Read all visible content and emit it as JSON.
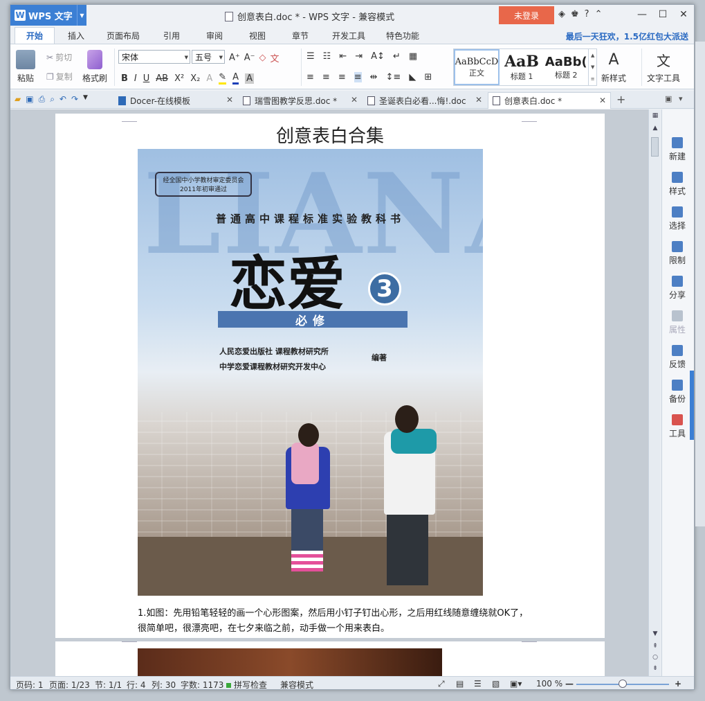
{
  "app": {
    "name": "WPS 文字",
    "window_title": "创意表白.doc * - WPS 文字 - 兼容模式",
    "login_label": "未登录",
    "help_label": "?"
  },
  "menu": {
    "tabs": [
      "开始",
      "插入",
      "页面布局",
      "引用",
      "审阅",
      "视图",
      "章节",
      "开发工具",
      "特色功能"
    ],
    "promo": "最后一天狂欢，1.5亿红包大派送"
  },
  "ribbon": {
    "paste": "粘贴",
    "cut": "剪切",
    "copy": "复制",
    "format_painter": "格式刷",
    "font_name": "宋体",
    "font_size": "五号",
    "styles": [
      {
        "sample": "AaBbCcD",
        "name": "正文"
      },
      {
        "sample": "AaB",
        "name": "标题 1"
      },
      {
        "sample": "AaBb(",
        "name": "标题 2"
      }
    ],
    "new_style": "新样式",
    "text_tools": "文字工具"
  },
  "doc_tabs": [
    {
      "label": "Docer-在线模板"
    },
    {
      "label": "瑞雪图教学反思.doc *"
    },
    {
      "label": "圣诞表白必看...悔!.doc"
    },
    {
      "label": "创意表白.doc *"
    }
  ],
  "document": {
    "title": "创意表白合集",
    "cover": {
      "bg_letters": "LIANAI",
      "seal_line1": "经全国中小学教材审定委员会",
      "seal_line2": "2011年初审通过",
      "series": "普通高中课程标准实验教科书",
      "big_title": "恋爱",
      "volume": "3",
      "band": "必修",
      "publisher_line1": "人民恋爱出版社 课程教材研究所",
      "publisher_line2": "中学恋爱课程教材研究开发中心",
      "edit_label": "编著"
    },
    "paragraph": "1.如图：先用铅笔轻轻的画一个心形图案，然后用小钉子钉出心形，之后用红线随意缠绕就OK了，很简单吧，很漂亮吧，在七夕来临之前，动手做一个用来表白。"
  },
  "task_pane": [
    "新建",
    "样式",
    "选择",
    "限制",
    "分享",
    "属性",
    "反馈",
    "备份",
    "工具"
  ],
  "status": {
    "page_num": "页码: 1",
    "page_count": "页面: 1/23",
    "section": "节: 1/1",
    "row": "行: 4",
    "col": "列: 30",
    "word_count": "字数: 1173",
    "spell_check": "拼写检查",
    "mode": "兼容模式",
    "zoom": "100 %",
    "zoom_level": 0.5
  },
  "colors": {
    "accent": "#3b7fd4",
    "login": "#e8674a"
  }
}
